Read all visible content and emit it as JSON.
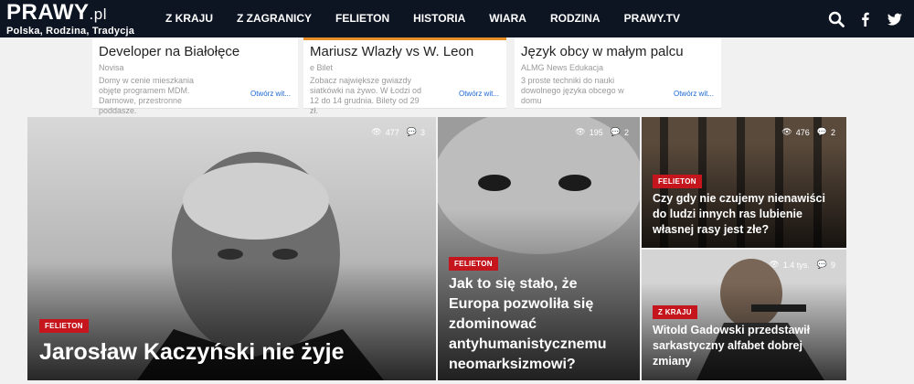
{
  "logo": {
    "main": "PRAWY",
    "tld": ".pl",
    "tagline": "Polska, Rodzina, Tradycja"
  },
  "nav": [
    "Z KRAJU",
    "Z ZAGRANICY",
    "FELIETON",
    "HISTORIA",
    "WIARA",
    "RODZINA",
    "PRAWY.TV"
  ],
  "header_icons": [
    "search-icon",
    "facebook-icon",
    "twitter-icon"
  ],
  "ads": [
    {
      "title": "Developer na Białołęce",
      "source": "Novisa",
      "desc": "Domy w cenie mieszkania objęte programem MDM. Darmowe, przestronne poddasze.",
      "open": "Otwórz wit...",
      "accent": "#ffffff"
    },
    {
      "title": "Mariusz Wlazły vs W. Leon",
      "source": "e Bilet",
      "desc": "Zobacz największe gwiazdy siatkówki na żywo. W Łodzi od 12 do 14 grudnia. Bilety od 29 zł.",
      "open": "Otwórz wit...",
      "accent": "#e8902a"
    },
    {
      "title": "Język obcy w małym palcu",
      "source": "ALMG News Edukacja",
      "desc": "3 proste techniki do nauki dowolnego języka obcego w domu",
      "open": "Otwórz wit...",
      "accent": "#ffffff"
    }
  ],
  "articles": [
    {
      "category": "FELIETON",
      "title": "Jarosław Kaczyński nie żyje",
      "views": "477",
      "comments": "3"
    },
    {
      "category": "FELIETON",
      "title": "Jak to się stało, że Europa pozwoliła się zdominować antyhumanistycznemu neomarksizmowi?",
      "views": "195",
      "comments": "2"
    },
    {
      "category": "FELIETON",
      "title": "Czy gdy nie czujemy nienawiści do ludzi innych ras lubienie własnej rasy jest złe?",
      "views": "476",
      "comments": "2"
    },
    {
      "category": "Z KRAJU",
      "title": "Witold Gadowski przedstawił sarkastyczny alfabet dobrej zmiany",
      "views": "1.4 tys.",
      "comments": "9"
    }
  ],
  "colors": {
    "topbar": "#0d1422",
    "badge": "#c4161c",
    "link": "#1a66d2"
  }
}
